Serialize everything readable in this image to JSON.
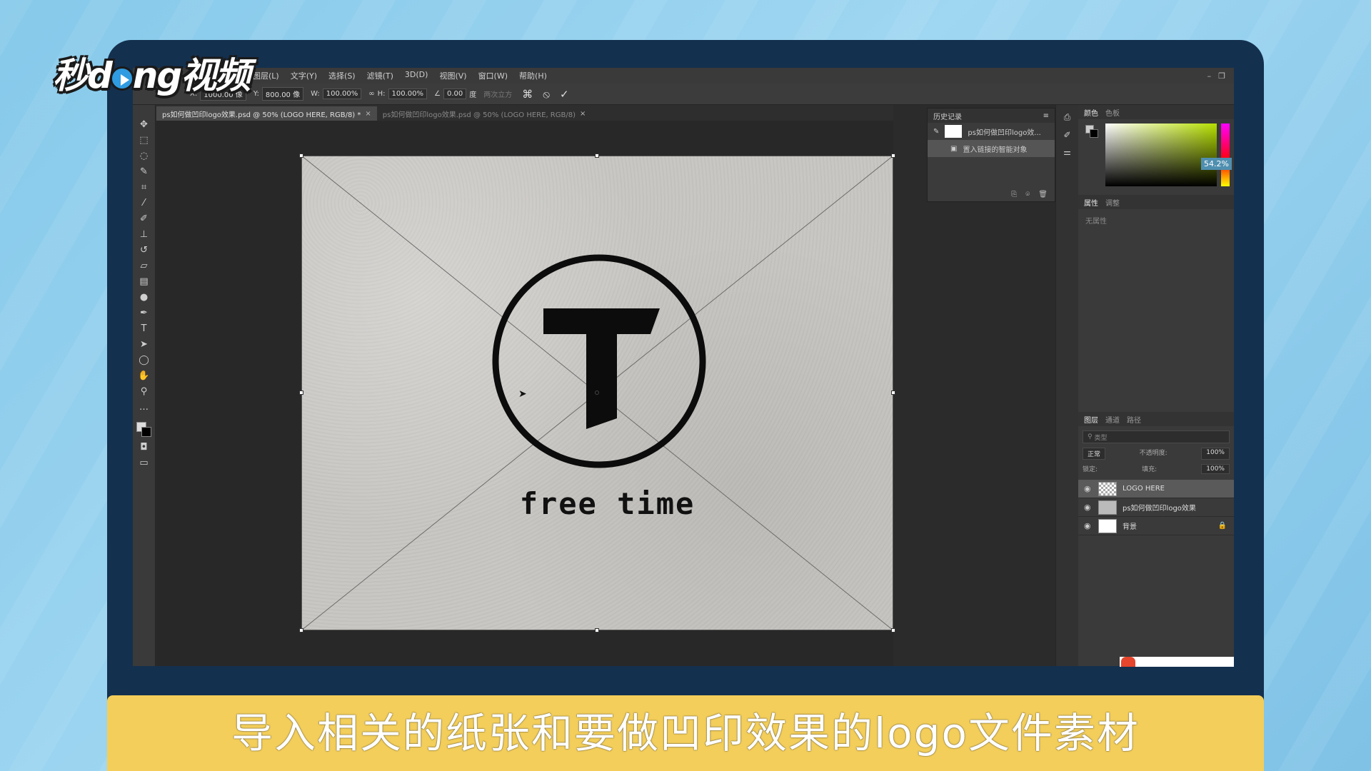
{
  "brand": {
    "text_left": "秒d",
    "text_right": "ng视频"
  },
  "menubar": {
    "items": [
      "图层(L)",
      "文字(Y)",
      "选择(S)",
      "滤镜(T)",
      "3D(D)",
      "视图(V)",
      "窗口(W)",
      "帮助(H)"
    ],
    "minimize": "–",
    "restore": "❐"
  },
  "options": {
    "x_label": "X:",
    "x_value": "1000.00 像",
    "y_label": "Y:",
    "y_value": "800.00 像",
    "w_label": "W:",
    "w_value": "100.00%",
    "h_label": "H:",
    "h_value": "100.00%",
    "angle_value": "0.00",
    "angle_unit": "度",
    "interp": "两次立方",
    "cancel_symbol": "⦸",
    "commit_symbol": "✓"
  },
  "tabs": [
    {
      "label": "ps如何做凹印logo效果.psd @ 50% (LOGO HERE, RGB/8) *",
      "close": "×"
    },
    {
      "label": "ps如何做凹印logo效果.psd @ 50% (LOGO HERE, RGB/8)",
      "close": "×"
    }
  ],
  "logo": {
    "letter": "T",
    "text": "free time"
  },
  "history": {
    "title": "历史记录",
    "items": [
      "ps如何做凹印logo效...",
      "置入链接的智能对象"
    ]
  },
  "color_panel": {
    "tab1": "颜色",
    "tab2": "色板",
    "percent": "54.2%"
  },
  "props_panel": {
    "tab1": "属性",
    "tab2": "调整",
    "note": "无属性"
  },
  "layers_panel": {
    "tab1": "图层",
    "tab2": "通道",
    "tab3": "路径",
    "search_placeholder": "类型",
    "blend_mode": "正常",
    "opacity_label": "不透明度:",
    "opacity_value": "100%",
    "lock_label": "锁定:",
    "fill_label": "填充:",
    "fill_value": "100%",
    "layers": [
      {
        "name": "LOGO HERE"
      },
      {
        "name": "ps如何做凹印logo效果"
      },
      {
        "name": "背景"
      }
    ]
  },
  "caption": "导入相关的纸张和要做凹印效果的logo文件素材",
  "colors": {
    "caption_bg": "#f3ce5a",
    "bezel": "#14304f",
    "accent": "#4f8fb0"
  }
}
